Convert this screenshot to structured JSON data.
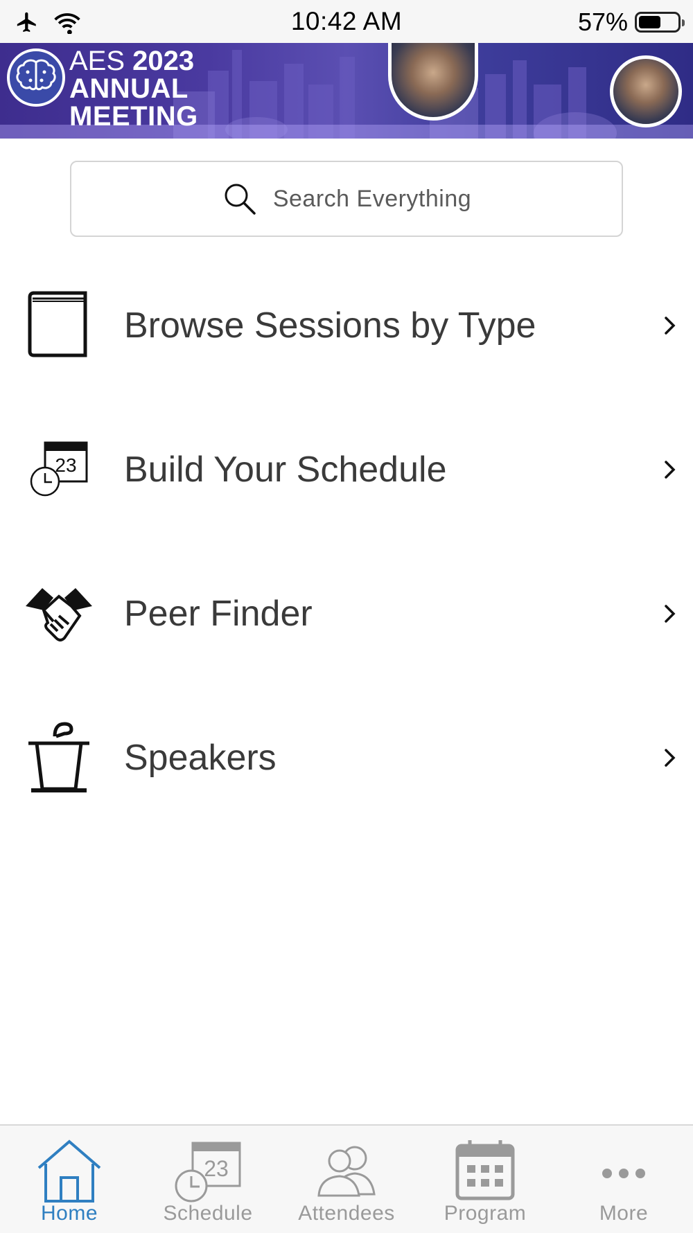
{
  "status_bar": {
    "time": "10:42 AM",
    "battery_percent": "57%",
    "battery_level": 0.57,
    "icons": [
      "airplane-icon",
      "wifi-icon",
      "battery-icon"
    ]
  },
  "banner": {
    "line1_light": "AES",
    "line1_bold": "2023",
    "line2": "ANNUAL",
    "line3": "MEETING",
    "colors": {
      "background": "#4a3aa0",
      "text": "#ffffff"
    }
  },
  "search": {
    "placeholder": "Search Everything",
    "icon": "search-icon"
  },
  "menu": {
    "items": [
      {
        "label": "Browse Sessions by Type",
        "icon": "book-icon"
      },
      {
        "label": "Build Your Schedule",
        "icon": "calendar-clock-icon"
      },
      {
        "label": "Peer Finder",
        "icon": "handshake-icon"
      },
      {
        "label": "Speakers",
        "icon": "podium-icon"
      }
    ]
  },
  "tab_bar": {
    "active_color": "#2f7fc1",
    "inactive_color": "#9a9a9a",
    "tabs": [
      {
        "label": "Home",
        "icon": "home-icon",
        "active": true
      },
      {
        "label": "Schedule",
        "icon": "calendar-clock-icon",
        "active": false
      },
      {
        "label": "Attendees",
        "icon": "people-icon",
        "active": false
      },
      {
        "label": "Program",
        "icon": "calendar-grid-icon",
        "active": false
      },
      {
        "label": "More",
        "icon": "more-dots-icon",
        "active": false
      }
    ]
  }
}
